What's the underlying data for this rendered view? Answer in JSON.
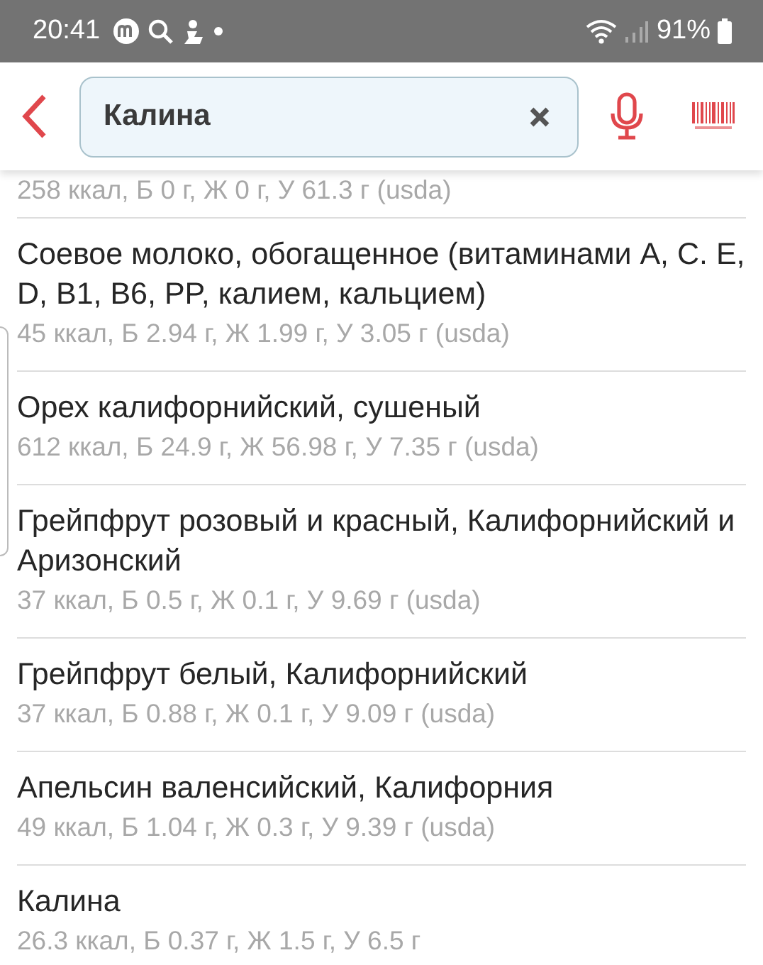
{
  "status_bar": {
    "time": "20:41",
    "battery": "91%"
  },
  "search": {
    "value": "Калина"
  },
  "partial_item": {
    "nutrition": "258 ккал, Б 0 г, Ж 0 г, У 61.3 г (usda)"
  },
  "items": [
    {
      "name": "Соевое молоко, обогащенное (витаминами A, C. E, D, B1, B6, PP, калием, кальцием)",
      "nutrition": "45 ккал, Б 2.94 г, Ж 1.99 г, У 3.05 г (usda)"
    },
    {
      "name": "Орех калифорнийский, сушеный",
      "nutrition": "612 ккал, Б 24.9 г, Ж 56.98 г, У 7.35 г (usda)"
    },
    {
      "name": "Грейпфрут розовый и красный, Калифорнийский и Аризонский",
      "nutrition": "37 ккал, Б 0.5 г, Ж 0.1 г, У 9.69 г (usda)"
    },
    {
      "name": "Грейпфрут белый, Калифорнийский",
      "nutrition": "37 ккал, Б 0.88 г, Ж 0.1 г, У 9.09 г (usda)"
    },
    {
      "name": "Апельсин валенсийский, Калифорния",
      "nutrition": "49 ккал, Б 1.04 г, Ж 0.3 г, У 9.39 г (usda)"
    },
    {
      "name": "Калина",
      "nutrition": "26.3 ккал, Б 0.37 г, Ж 1.5 г, У 6.5 г"
    }
  ]
}
